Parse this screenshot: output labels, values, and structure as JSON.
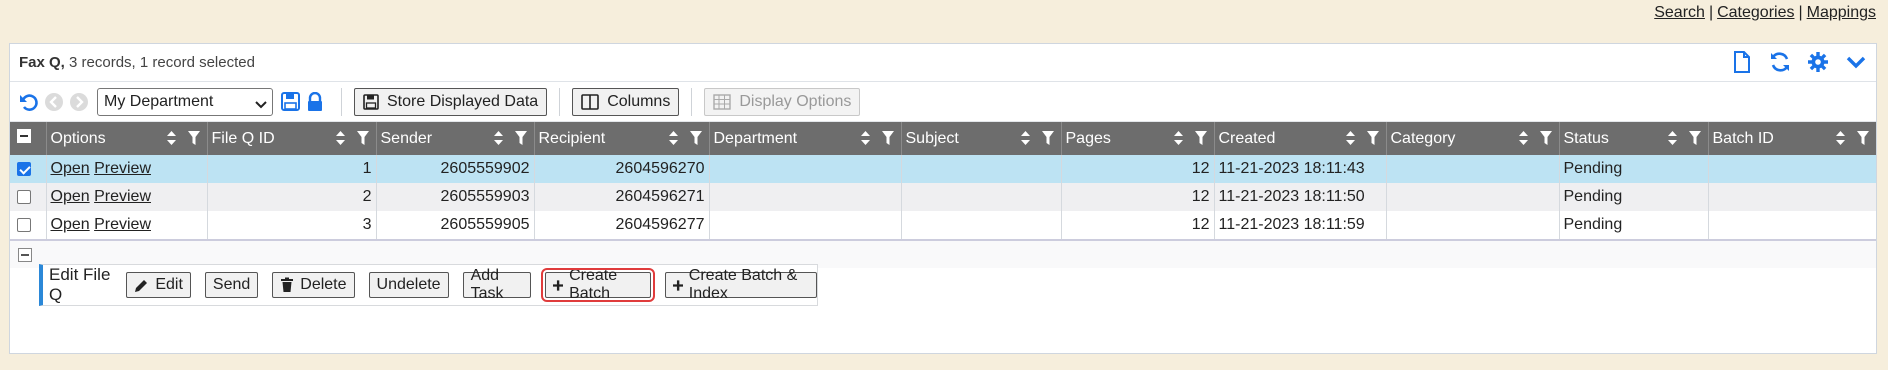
{
  "toplinks": {
    "search": "Search",
    "categories": "Categories",
    "mappings": "Mappings",
    "sep": "|"
  },
  "panel": {
    "title": "Fax Q,",
    "subtitle": " 3 records, 1 record selected"
  },
  "toolbar": {
    "department": "My Department",
    "store_label": "Store Displayed Data",
    "columns_label": "Columns",
    "display_options_label": "Display Options"
  },
  "columns": [
    "Options",
    "File Q ID",
    "Sender",
    "Recipient",
    "Department",
    "Subject",
    "Pages",
    "Created",
    "Category",
    "Status",
    "Batch ID"
  ],
  "rows": [
    {
      "open": "Open",
      "preview": "Preview",
      "id": "1",
      "sender": "2605559902",
      "recipient": "2604596270",
      "department": "",
      "subject": "",
      "pages": "12",
      "created": "11-21-2023 18:11:43",
      "category": "",
      "status": "Pending",
      "batch": ""
    },
    {
      "open": "Open",
      "preview": "Preview",
      "id": "2",
      "sender": "2605559903",
      "recipient": "2604596271",
      "department": "",
      "subject": "",
      "pages": "12",
      "created": "11-21-2023 18:11:50",
      "category": "",
      "status": "Pending",
      "batch": ""
    },
    {
      "open": "Open",
      "preview": "Preview",
      "id": "3",
      "sender": "2605559905",
      "recipient": "2604596277",
      "department": "",
      "subject": "",
      "pages": "12",
      "created": "11-21-2023 18:11:59",
      "category": "",
      "status": "Pending",
      "batch": ""
    }
  ],
  "actions": {
    "label": "Edit File Q",
    "edit": "Edit",
    "send": "Send",
    "delete": "Delete",
    "undelete": "Undelete",
    "add_task": "Add Task",
    "create_batch": "Create Batch",
    "create_batch_index": "Create Batch & Index"
  },
  "colors": {
    "accent": "#1a73e8",
    "header": "#6d6d6d",
    "selected_row": "#bde3f3",
    "highlight": "#e03c3c"
  }
}
